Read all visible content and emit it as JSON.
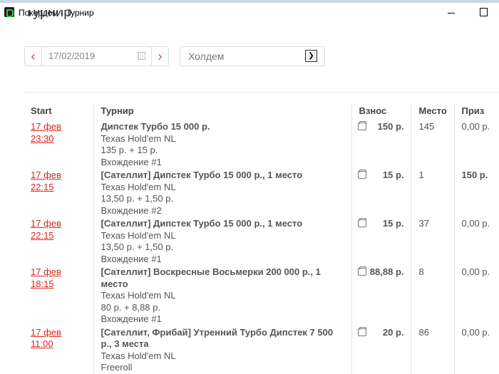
{
  "window": {
    "title": "Покердом - Турнир"
  },
  "page": {
    "title": "Турнир"
  },
  "filters": {
    "date": "17/02/2019",
    "game": "Холдем"
  },
  "table": {
    "headers": [
      "Start",
      "Турнир",
      "Взнос",
      "Место",
      "Приз"
    ],
    "rows": [
      {
        "start": "17 фев 23:30",
        "name": "Дипстек Турбо 15 000 р.",
        "game": "Texas Hold'em NL",
        "buyin": "135 р. + 15 р.",
        "entry": "Вхождение #1",
        "fee": "150 р.",
        "place": "145",
        "prize": "0,00 р.",
        "prize_bold": false
      },
      {
        "start": "17 фев 22:15",
        "name": "[Сателлит] Дипстек Турбо 15 000 р., 1 место",
        "game": "Texas Hold'em NL",
        "buyin": "13,50 р. + 1,50 р.",
        "entry": "Вхождение #2",
        "fee": "15 р.",
        "place": "1",
        "prize": "150 р.",
        "prize_bold": true
      },
      {
        "start": "17 фев 22:15",
        "name": "[Сателлит] Дипстек Турбо 15 000 р., 1 место",
        "game": "Texas Hold'em NL",
        "buyin": "13,50 р. + 1,50 р.",
        "entry": "Вхождение #1",
        "fee": "15 р.",
        "place": "37",
        "prize": "0,00 р.",
        "prize_bold": false
      },
      {
        "start": "17 фев 18:15",
        "name": "[Сателлит] Воскресные Восьмерки 200 000 р., 1 место",
        "game": "Texas Hold'em NL",
        "buyin": "80 р. + 8,88 р.",
        "entry": "Вхождение #1",
        "fee": "88,88 р.",
        "place": "8",
        "prize": "0,00 р.",
        "prize_bold": false
      },
      {
        "start": "17 фев 11:00",
        "name": "[Сателлит, Фрибай] Утренний Турбо Дипстек 7 500 р., 3 места",
        "game": "Texas Hold'em NL",
        "buyin": "Freeroll",
        "entry": "",
        "fee": "20 р.",
        "place": "86",
        "prize": "0,00 р.",
        "prize_bold": false
      }
    ]
  }
}
